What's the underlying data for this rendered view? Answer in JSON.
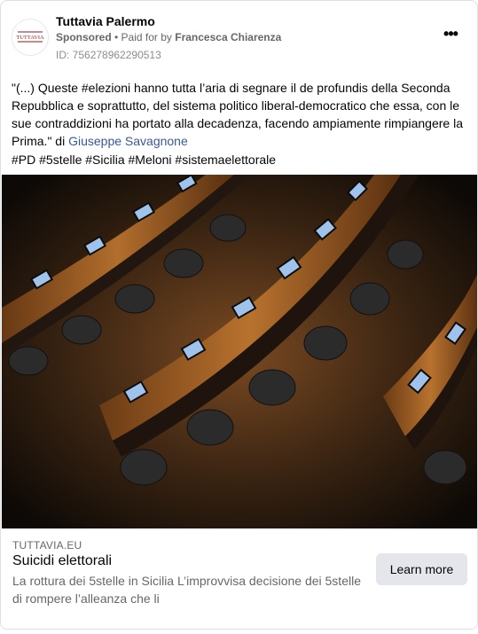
{
  "page": {
    "name": "Tuttavia Palermo",
    "avatar_text": "TUTTAVIA",
    "sponsored_label": "Sponsored",
    "paid_for_prefix": " • Paid for by ",
    "payer": "Francesca Chiarenza",
    "ad_id": "ID: 756278962290513",
    "more_icon": "•••"
  },
  "post": {
    "text_line": "\"(...) Queste #elezioni hanno tutta l’aria di segnare il de profundis della Seconda Repubblica e soprattutto, del sistema politico liberal-democratico che essa, con le sue contraddizioni ha portato alla decadenza, facendo ampiamente rimpiangere la Prima.\" di ",
    "author": "Giuseppe Savagnone",
    "hashtags": "#PD #5stelle #Sicilia #Meloni #sistemaelettorale"
  },
  "link": {
    "domain": "TUTTAVIA.EU",
    "headline": "Suicidi elettorali",
    "description": "La rottura dei 5stelle in Sicilia L’improvvisa decisione dei 5stelle di rompere l’alleanza che li",
    "cta_label": "Learn more"
  },
  "colors": {
    "author_link": "#385898",
    "cta_bg": "#e4e6eb",
    "meta_text": "#65676b"
  }
}
